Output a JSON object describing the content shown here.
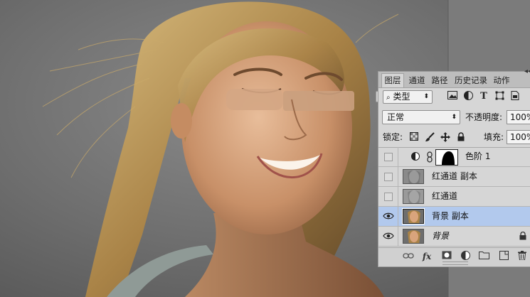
{
  "tabs": [
    "图层",
    "通道",
    "路径",
    "历史记录",
    "动作"
  ],
  "active_tab": "图层",
  "filter": {
    "label": "类型",
    "icon": "search-icon"
  },
  "toolbar_icons": [
    "image-filter-icon",
    "adjustment-filter-icon",
    "text-filter-icon",
    "shape-filter-icon",
    "smart-object-filter-icon"
  ],
  "blend_mode": "正常",
  "opacity_label": "不透明度:",
  "opacity_value": "100%",
  "lock_label": "锁定:",
  "lock_icons": [
    "lock-transparent-icon",
    "lock-paint-icon",
    "lock-position-icon",
    "lock-all-icon"
  ],
  "fill_label": "填充:",
  "fill_value": "100%",
  "layers": [
    {
      "name": "色阶 1",
      "visible": false,
      "type": "adjustment"
    },
    {
      "name": "红通道 副本",
      "visible": false,
      "type": "grayscale"
    },
    {
      "name": "红通道",
      "visible": false,
      "type": "grayscale"
    },
    {
      "name": "背景 副本",
      "visible": true,
      "selected": true,
      "type": "photo"
    },
    {
      "name": "背景",
      "visible": true,
      "locked": true,
      "italic": true,
      "type": "photo"
    }
  ],
  "footer_icons": [
    "link-layers-icon",
    "fx-icon",
    "mask-icon",
    "adjustment-layer-icon",
    "group-folder-icon",
    "new-layer-icon",
    "trash-icon"
  ],
  "fx_label": "fx"
}
